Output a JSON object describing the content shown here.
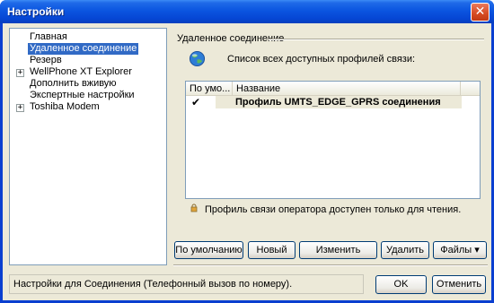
{
  "window": {
    "title": "Настройки"
  },
  "tree": {
    "items": [
      {
        "label": "Главная",
        "selected": false,
        "expandable": false
      },
      {
        "label": "Удаленное соединение",
        "selected": true,
        "expandable": false
      },
      {
        "label": "Резерв",
        "selected": false,
        "expandable": false
      },
      {
        "label": "WellPhone XT Explorer",
        "selected": false,
        "expandable": true
      },
      {
        "label": "Дополнить вживую",
        "selected": false,
        "expandable": false
      },
      {
        "label": "Экспертные настройки",
        "selected": false,
        "expandable": false
      },
      {
        "label": "Toshiba Modem",
        "selected": false,
        "expandable": true
      }
    ]
  },
  "panel": {
    "group_title": "Удаленное соединение",
    "list_caption": "Список всех доступных профилей связи:",
    "columns": [
      "По умо...",
      "Название"
    ],
    "rows": [
      {
        "default_mark": "✔",
        "name": "Профиль UMTS_EDGE_GPRS соединения"
      }
    ],
    "note": "Профиль связи оператора доступен только для чтения."
  },
  "buttons": {
    "default": "По умолчанию",
    "new": "Новый",
    "edit": "Изменить",
    "delete": "Удалить",
    "files": "Файлы ▾"
  },
  "status": "Настройки для Соединения (Телефонный вызов по номеру).",
  "dialog": {
    "ok": "OK",
    "cancel": "Отменить"
  },
  "colors": {
    "title_bar": "#0b55e0",
    "selection": "#316ac5",
    "close_button": "#d64a22"
  }
}
